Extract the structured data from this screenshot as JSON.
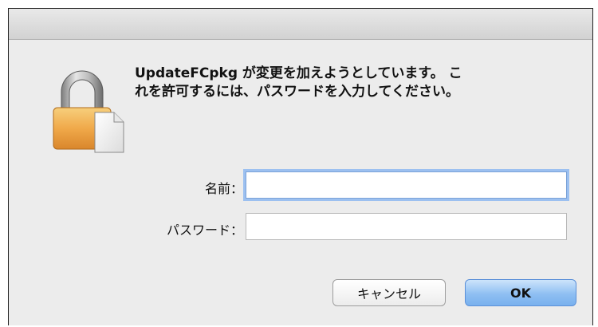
{
  "dialog": {
    "message": "UpdateFCpkg が変更を加えようとしています。 こ\nれを許可するには、パスワードを入力してください。",
    "icon": "lock-document-icon"
  },
  "fields": {
    "name": {
      "label": "名前：",
      "value": ""
    },
    "password": {
      "label": "パスワード：",
      "value": ""
    }
  },
  "buttons": {
    "cancel_label": "キャンセル",
    "ok_label": "OK"
  },
  "colors": {
    "focus_ring": "#9cc0f0",
    "default_button": "#8fbff2",
    "lock_gold": "#f0a94a"
  }
}
